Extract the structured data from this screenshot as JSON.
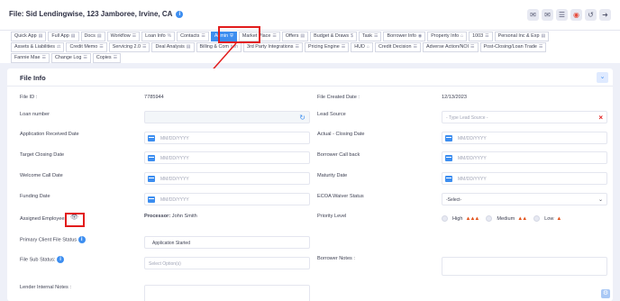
{
  "header": {
    "file_title": "File: Sid Lendingwise, 123 Jamboree, Irvine, CA",
    "info_icon": "info-icon",
    "icons": [
      "chat-icon",
      "mail-icon",
      "mail-open-icon",
      "alert-icon",
      "share-icon",
      "forward-icon"
    ]
  },
  "tabs": {
    "row1": [
      {
        "label": "Quick App",
        "icon": "▤"
      },
      {
        "label": "Full App",
        "icon": "▤"
      },
      {
        "label": "Docs",
        "icon": "▤"
      },
      {
        "label": "Workflow",
        "icon": "☰"
      },
      {
        "label": "Loan Info",
        "icon": "%"
      },
      {
        "label": "Contacts",
        "icon": "☰"
      },
      {
        "label": "Admin",
        "icon": "⛨"
      },
      {
        "label": "Market Place",
        "icon": "☰"
      },
      {
        "label": "Offers",
        "icon": "▤"
      },
      {
        "label": "Budget & Draws",
        "icon": "$"
      },
      {
        "label": "Task",
        "icon": "☰"
      },
      {
        "label": "Borrower Info",
        "icon": "◉"
      },
      {
        "label": "Property Info",
        "icon": "⌂"
      },
      {
        "label": "1003",
        "icon": "☰"
      },
      {
        "label": "Personal Inc & Exp",
        "icon": "▤"
      }
    ],
    "row2": [
      {
        "label": "Assets & Liabilities",
        "icon": "⚖"
      },
      {
        "label": "Credit Memo",
        "icon": "☰"
      },
      {
        "label": "Servicing 2.0",
        "icon": "☰"
      },
      {
        "label": "Deal Analysis",
        "icon": "▤"
      },
      {
        "label": "Billing & Com",
        "icon": "tion"
      },
      {
        "label": "3rd Party Integrations",
        "icon": "☰"
      },
      {
        "label": "Pricing Engine",
        "icon": "☰"
      },
      {
        "label": "HUD",
        "icon": "⌂"
      },
      {
        "label": "Credit Decision",
        "icon": "☰"
      },
      {
        "label": "Adverse Action/NOI",
        "icon": "☰"
      },
      {
        "label": "Post-Closing/Loan Trade",
        "icon": "☰"
      }
    ],
    "row3": [
      {
        "label": "Fannie Mae",
        "icon": "☰"
      },
      {
        "label": "Change Log",
        "icon": "☰"
      },
      {
        "label": "Copies",
        "icon": "☰"
      }
    ]
  },
  "file_info": {
    "title": "File Info",
    "file_id_label": "File ID :",
    "file_id_value": "7785944",
    "file_created_label": "File Created Date :",
    "file_created_value": "12/13/2023",
    "loan_number_label": "Loan number",
    "lead_source_label": "Lead Source",
    "lead_source_placeholder": "- Type Lead Source -",
    "app_received_label": "Application Received Date",
    "actual_closing_label": "Actual - Closing Date",
    "target_closing_label": "Target Closing Date",
    "borrower_callback_label": "Borrower Call back",
    "welcome_call_label": "Welcome Call Date",
    "maturity_label": "Maturity Date",
    "funding_label": "Funding Date",
    "ecoa_label": "ECOA Waiver Status",
    "ecoa_value": "-Select-",
    "assigned_label": "Assigned Employees",
    "processor_label": "Processor:",
    "processor_value": "John Smith",
    "priority_label": "Priority Level",
    "priority_high": "High",
    "priority_medium": "Medium",
    "priority_low": "Low",
    "primary_status_label": "Primary Client File Status",
    "primary_status_value": "Application Started",
    "sub_status_label": "File Sub Status:",
    "sub_status_placeholder": "Select Option(s)",
    "borrower_notes_label": "Borrower Notes :",
    "lender_notes_label": "Lender Internal Notes :",
    "date_placeholder": "MM/DD/YYYY"
  },
  "colors": {
    "accent": "#3d8ef0",
    "highlight": "#e21c1c"
  }
}
